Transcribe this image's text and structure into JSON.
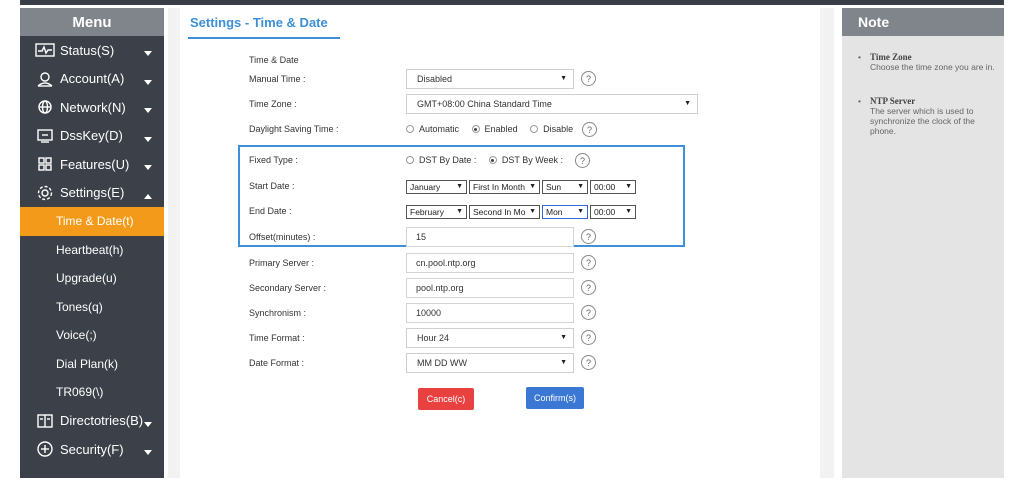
{
  "menu": {
    "header": "Menu",
    "items": [
      {
        "label": "Status(S)",
        "icon": "status-icon",
        "arrow": "▼"
      },
      {
        "label": "Account(A)",
        "icon": "account-icon",
        "arrow": "▼"
      },
      {
        "label": "Network(N)",
        "icon": "network-icon",
        "arrow": "▼"
      },
      {
        "label": "DssKey(D)",
        "icon": "dsskey-icon",
        "arrow": "▼"
      },
      {
        "label": "Features(U)",
        "icon": "features-icon",
        "arrow": "▼"
      },
      {
        "label": "Settings(E)",
        "icon": "settings-icon",
        "arrow": "▲"
      }
    ],
    "subitems": [
      "Time & Date(t)",
      "Heartbeat(h)",
      "Upgrade(u)",
      "Tones(q)",
      "Voice(;)",
      "Dial Plan(k)",
      "TR069(\\)"
    ],
    "bottom_items": [
      {
        "label": "Directotries(B)",
        "icon": "directories-icon",
        "arrow": "▼"
      },
      {
        "label": "Security(F)",
        "icon": "security-icon",
        "arrow": "▼"
      }
    ]
  },
  "page": {
    "title": "Settings - Time & Date",
    "section_label": "Time & Date"
  },
  "form": {
    "manual_time": {
      "label": "Manual Time :",
      "value": "Disabled"
    },
    "time_zone": {
      "label": "Time Zone :",
      "value": "GMT+08:00 China Standard Time"
    },
    "daylight_saving": {
      "label": "Daylight Saving Time :",
      "options": [
        "Automatic",
        "Enabled",
        "Disable"
      ],
      "selected": "Enabled"
    },
    "fixed_type": {
      "label": "Fixed Type :",
      "options": [
        "DST By Date :",
        "DST By Week :"
      ],
      "selected": "DST By Week :"
    },
    "start_date": {
      "label": "Start Date :",
      "month": "January",
      "week": "First In Month",
      "day": "Sun",
      "time": "00:00"
    },
    "end_date": {
      "label": "End Date :",
      "month": "February",
      "week": "Second In Mo",
      "day": "Mon",
      "time": "00:00"
    },
    "offset": {
      "label": "Offset(minutes) :",
      "value": "15"
    },
    "primary_server": {
      "label": "Primary Server :",
      "value": "cn.pool.ntp.org"
    },
    "secondary_server": {
      "label": "Secondary Server :",
      "value": "pool.ntp.org"
    },
    "synchronism": {
      "label": "Synchronism :",
      "value": "10000"
    },
    "time_format": {
      "label": "Time Format :",
      "value": "Hour 24"
    },
    "date_format": {
      "label": "Date Format :",
      "value": "MM DD WW"
    }
  },
  "buttons": {
    "cancel": "Cancel(c)",
    "confirm": "Confirm(s)"
  },
  "help_glyph": "?",
  "caret": "▼",
  "note": {
    "header": "Note",
    "items": [
      {
        "title": "Time Zone",
        "body": "Choose the time zone you are in."
      },
      {
        "title": "NTP Server",
        "body": "The server which is used to synchronize the clock of the phone."
      }
    ]
  },
  "colors": {
    "accent": "#f39a1a",
    "title_blue": "#3d8fd6",
    "cancel_red": "#e8413f",
    "confirm_blue": "#3b78d4",
    "sidebar": "#3b4049"
  }
}
